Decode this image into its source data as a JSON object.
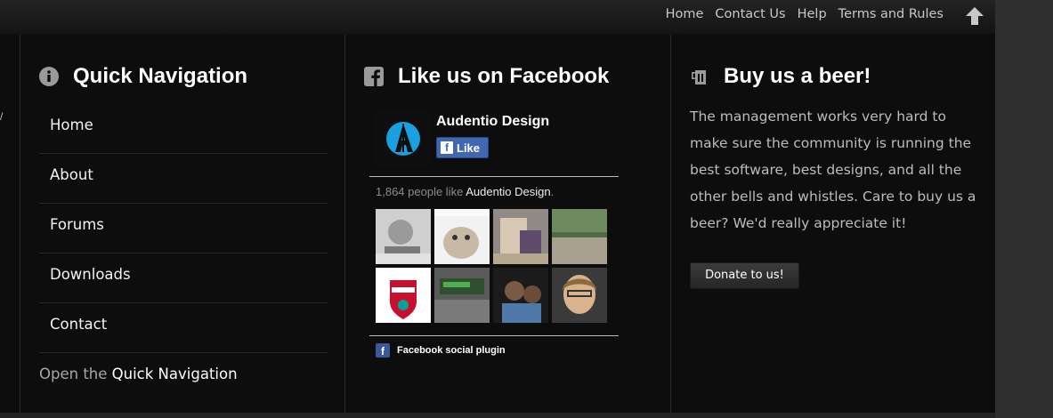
{
  "topnav": {
    "links": [
      "Home",
      "Contact Us",
      "Help",
      "Terms and Rules"
    ],
    "back_to_top_icon": "arrow-up-icon"
  },
  "quick_nav": {
    "title": "Quick Navigation",
    "icon": "info-icon",
    "items": [
      "Home",
      "About",
      "Forums",
      "Downloads",
      "Contact"
    ],
    "open_prefix": "Open the",
    "open_link": "Quick Navigation"
  },
  "facebook": {
    "title": "Like us on Facebook",
    "icon": "facebook-icon",
    "page_name": "Audentio Design",
    "like_label": "Like",
    "count_text": "1,864 people like",
    "count_page": "Audentio Design",
    "count_suffix": ".",
    "plugin_label": "Facebook social plugin",
    "face_count": 8
  },
  "beer": {
    "title": "Buy us a beer!",
    "icon": "beer-icon",
    "text": "The management works very hard to make sure the community is running the best software, best designs, and all the other bells and whistles. Care to buy us a beer? We'd really appreciate it!",
    "button": "Donate to us!"
  },
  "colors": {
    "footer_bg": "#0d0d0d",
    "facebook_blue": "#4267b2"
  }
}
